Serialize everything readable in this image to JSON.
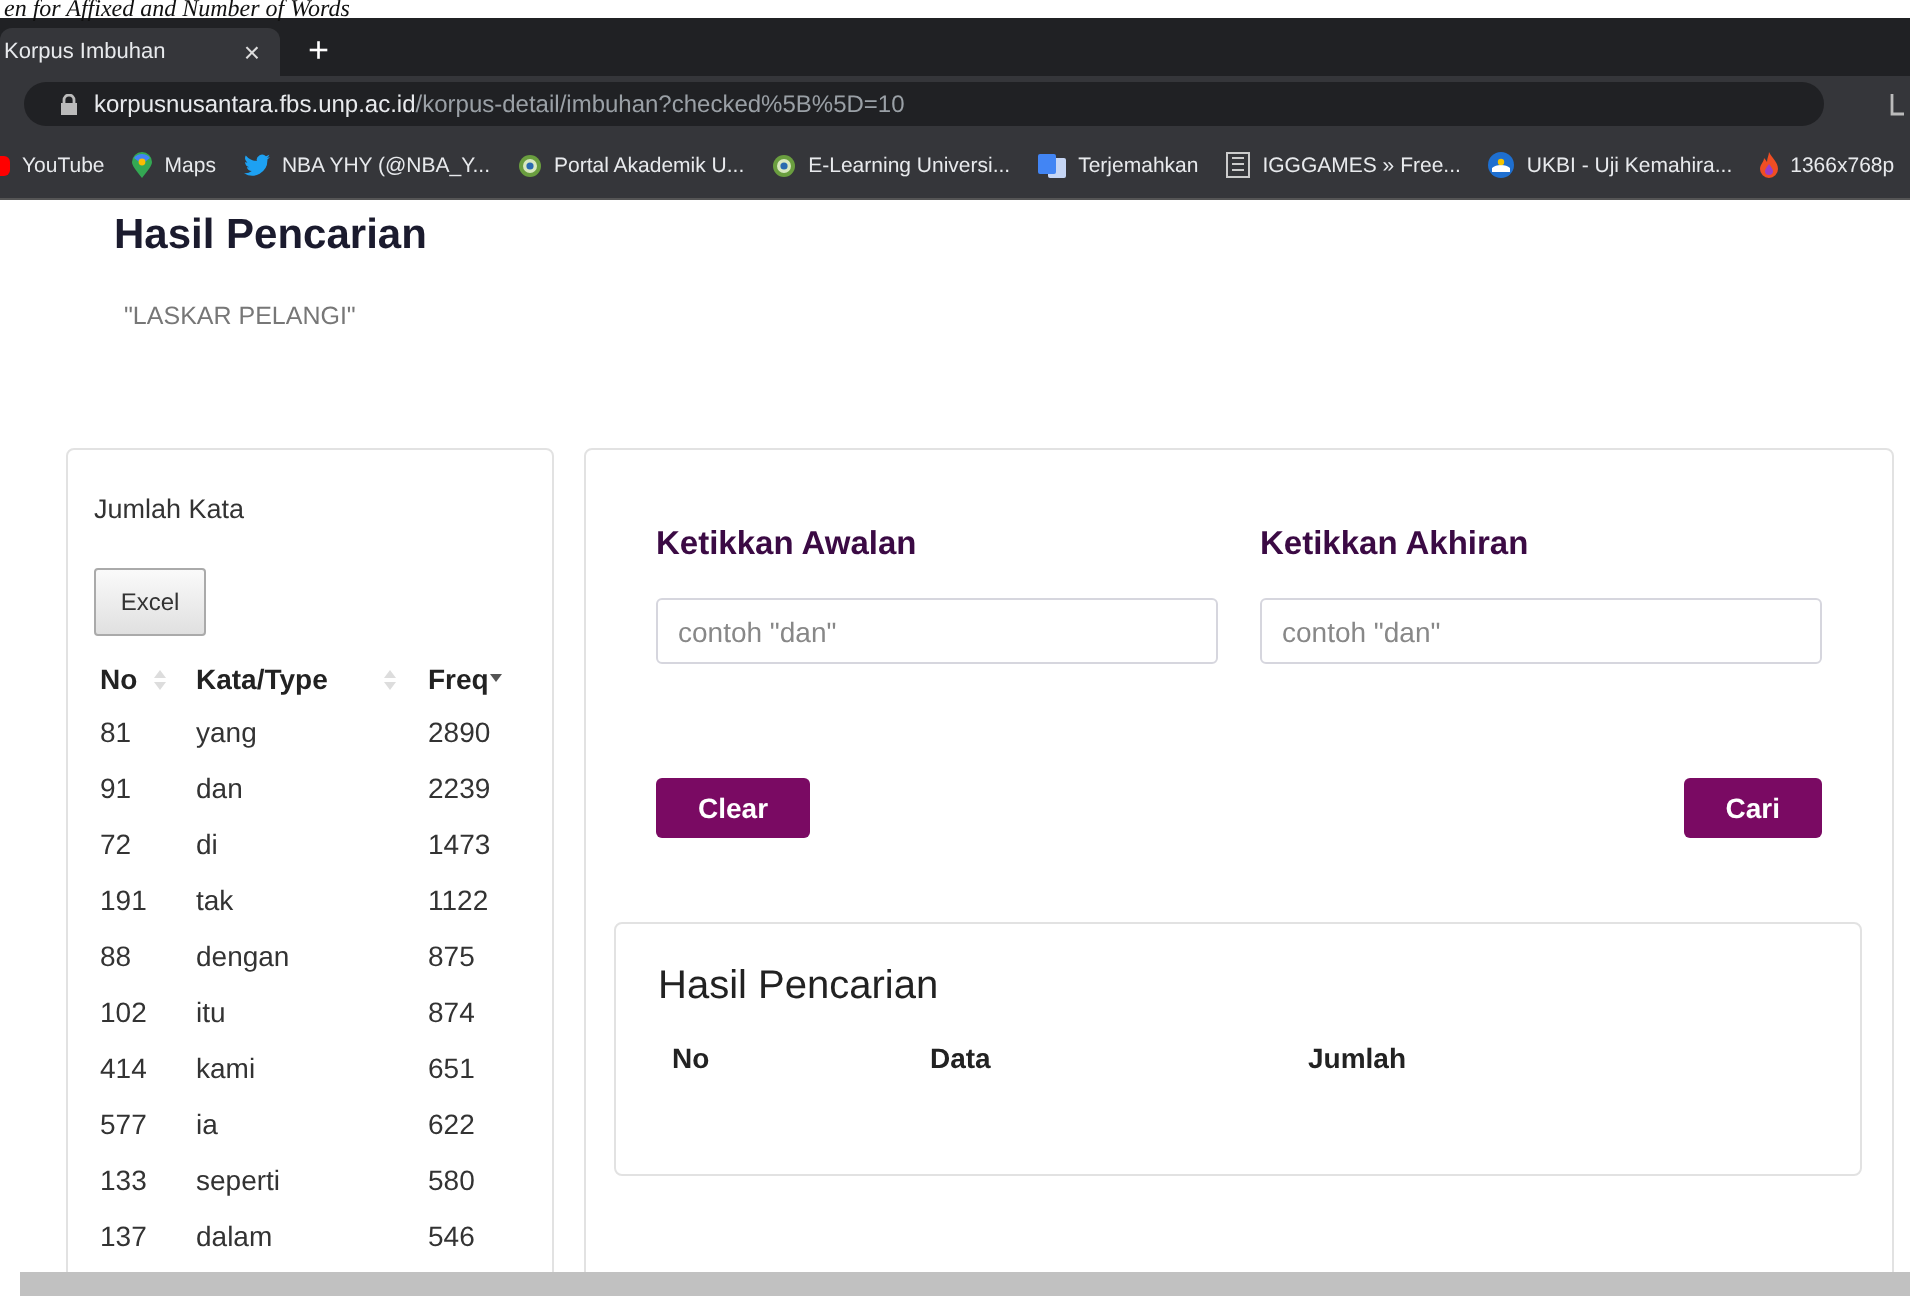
{
  "caption": "en for Affixed and Number of Words",
  "browser": {
    "tab": {
      "title": "Korpus Imbuhan",
      "close": "×"
    },
    "new_tab": "+",
    "url": {
      "domain": "korpusnusantara.fbs.unp.ac.id",
      "path": "/korpus-detail/imbuhan?checked%5B%5D=10"
    },
    "bookmarks": [
      {
        "label": "YouTube",
        "kind": "youtube"
      },
      {
        "label": "Maps",
        "kind": "pin"
      },
      {
        "label": "NBA YHY (@NBA_Y...",
        "kind": "bird"
      },
      {
        "label": "Portal Akademik U...",
        "kind": "emblem"
      },
      {
        "label": "E-Learning Universi...",
        "kind": "emblem"
      },
      {
        "label": "Terjemahkan",
        "kind": "translate"
      },
      {
        "label": "IGGGAMES » Free...",
        "kind": "doc"
      },
      {
        "label": "UKBI - Uji Kemahira...",
        "kind": "globe"
      },
      {
        "label": "1366x768p",
        "kind": "flame"
      }
    ]
  },
  "page": {
    "title": "Hasil Pencarian",
    "query": "\"LASKAR PELANGI\""
  },
  "word_panel": {
    "title": "Jumlah Kata",
    "export_button": "Excel",
    "columns": [
      {
        "label": "No",
        "sorted": false
      },
      {
        "label": "Kata/Type",
        "sorted": false
      },
      {
        "label": "Freq",
        "sorted": true
      }
    ],
    "rows": [
      [
        "81",
        "yang",
        "2890"
      ],
      [
        "91",
        "dan",
        "2239"
      ],
      [
        "72",
        "di",
        "1473"
      ],
      [
        "191",
        "tak",
        "1122"
      ],
      [
        "88",
        "dengan",
        "875"
      ],
      [
        "102",
        "itu",
        "874"
      ],
      [
        "414",
        "kami",
        "651"
      ],
      [
        "577",
        "ia",
        "622"
      ],
      [
        "133",
        "seperti",
        "580"
      ],
      [
        "137",
        "dalam",
        "546"
      ]
    ]
  },
  "search_form": {
    "fields": [
      {
        "label": "Ketikkan Awalan",
        "placeholder": "contoh \"dan\""
      },
      {
        "label": "Ketikkan Akhiran",
        "placeholder": "contoh \"dan\""
      }
    ],
    "buttons": [
      "Clear",
      "Cari"
    ]
  },
  "results": {
    "title": "Hasil Pencarian",
    "columns": [
      "No",
      "Data",
      "Jumlah"
    ]
  }
}
